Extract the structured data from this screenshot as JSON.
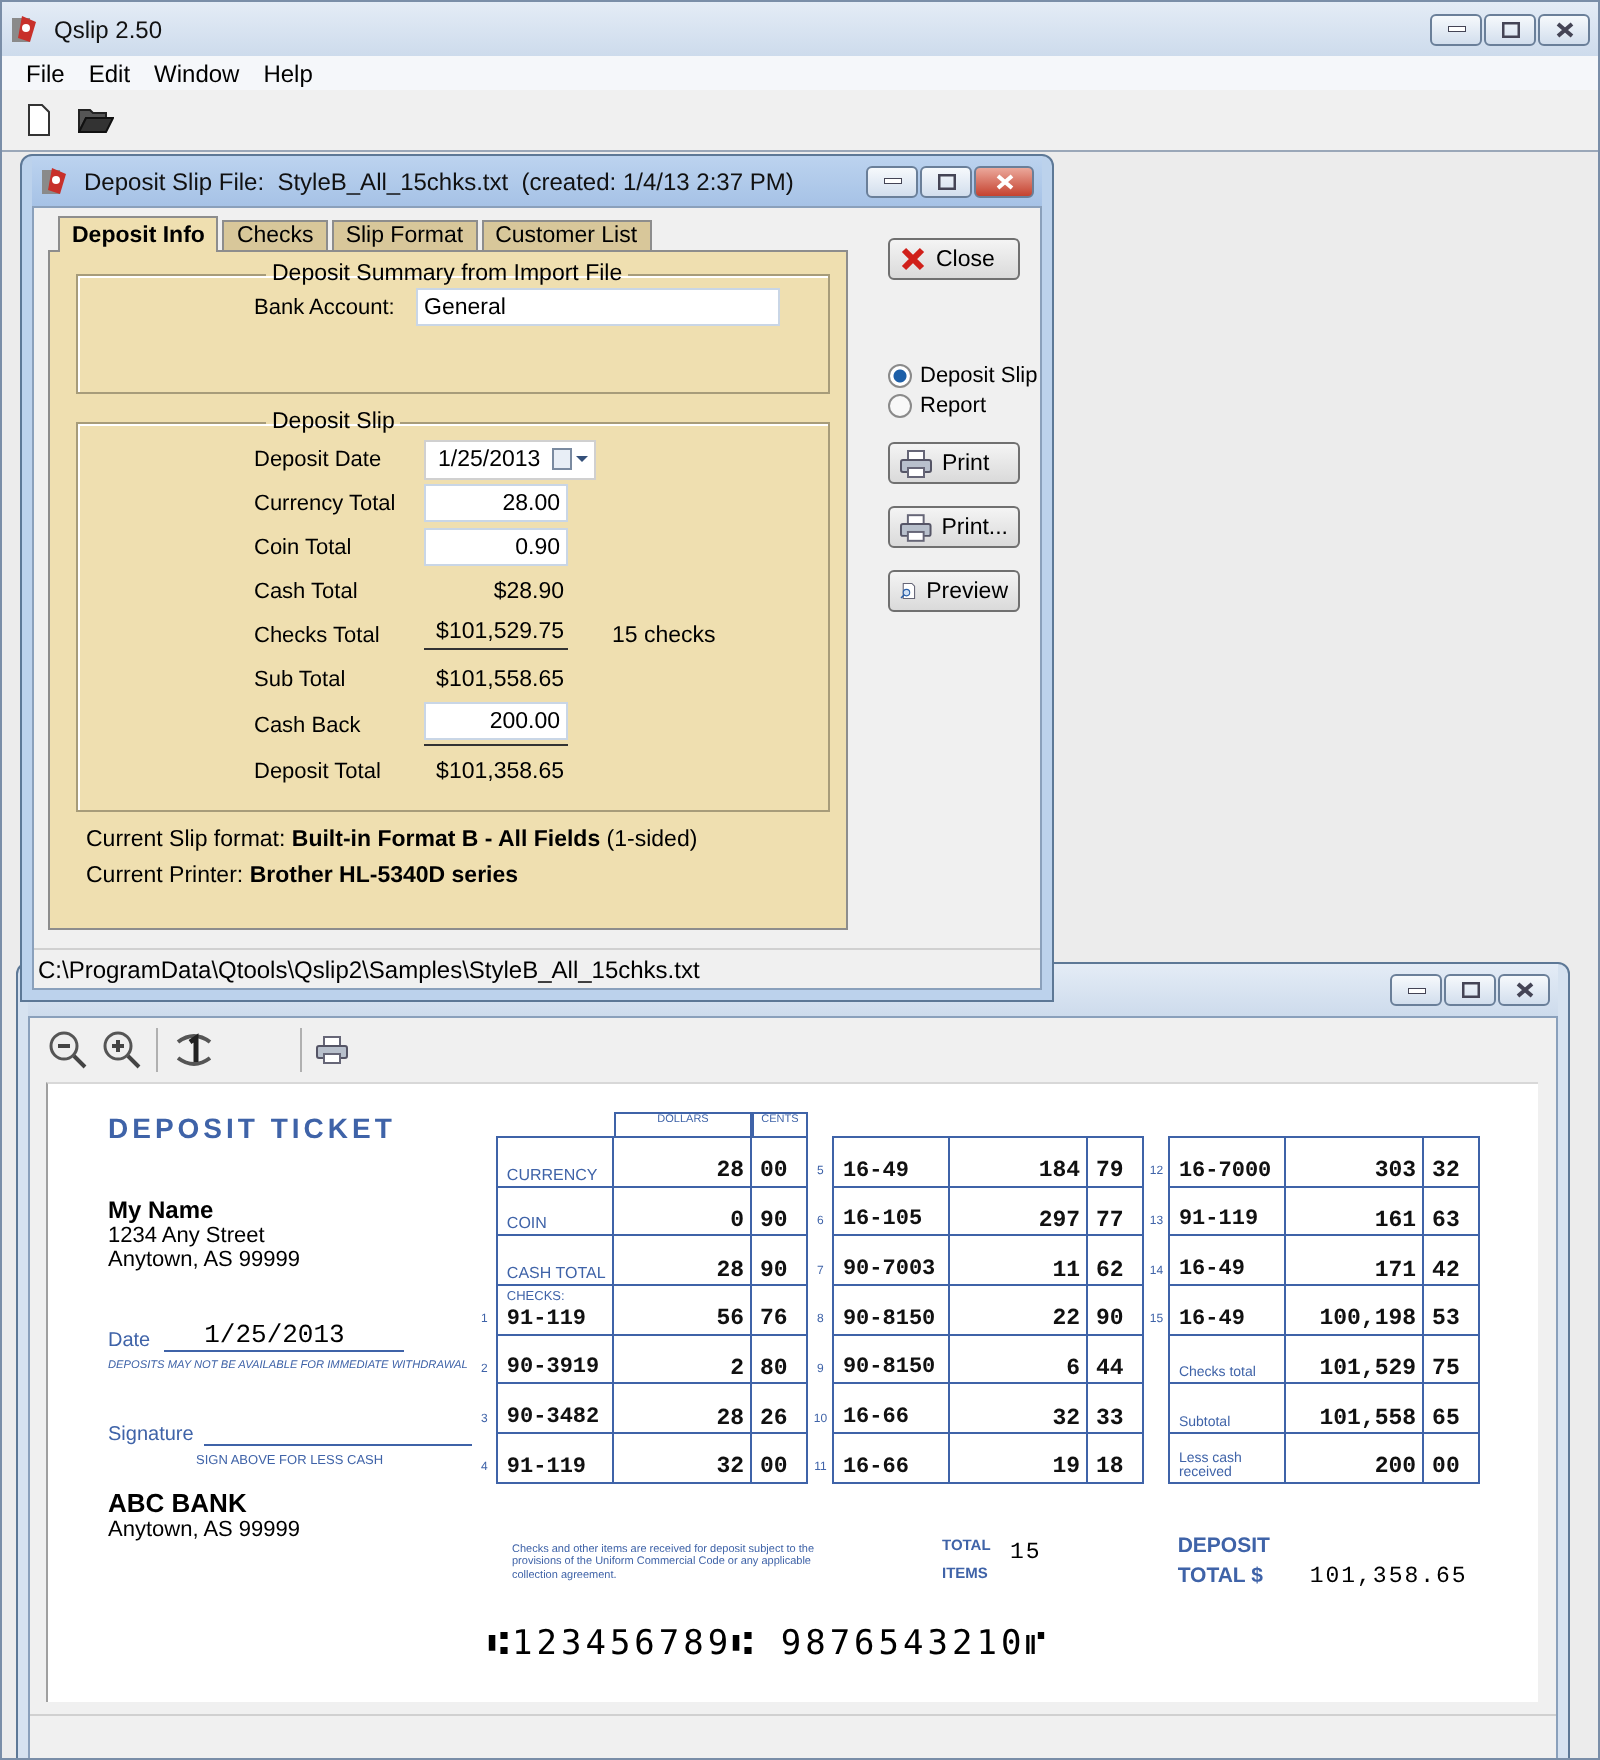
{
  "app": {
    "title": "Qslip 2.50",
    "menu": [
      "File",
      "Edit",
      "Window",
      "Help"
    ]
  },
  "dialog": {
    "title": "Deposit Slip File:  StyleB_All_15chks.txt  (created: 1/4/13 2:37 PM)",
    "tabs": [
      {
        "label": "Deposit Info",
        "selected": true
      },
      {
        "label": "Checks",
        "selected": false
      },
      {
        "label": "Slip Format",
        "selected": false
      },
      {
        "label": "Customer List",
        "selected": false
      }
    ],
    "summary_group": {
      "legend": "Deposit Summary from Import File",
      "label": "Bank Account:",
      "value": "General"
    },
    "slip_group": {
      "legend": "Deposit Slip",
      "rows": [
        {
          "kind": "date",
          "label": "Deposit Date",
          "value": "1/25/2013",
          "rule_below": false
        },
        {
          "kind": "input",
          "label": "Currency Total",
          "value": "28.00",
          "rule_below": false
        },
        {
          "kind": "input",
          "label": "Coin Total",
          "value": "0.90",
          "rule_below": false
        },
        {
          "kind": "text",
          "label": "Cash Total",
          "value": "$28.90",
          "rule_below": false
        },
        {
          "kind": "text",
          "label": "Checks Total",
          "value": "$101,529.75",
          "note": "15 checks",
          "rule_below": true
        },
        {
          "kind": "text",
          "label": "Sub Total",
          "value": "$101,558.65",
          "rule_below": false
        },
        {
          "kind": "input",
          "label": "Cash Back",
          "value": "200.00",
          "rule_below": true
        },
        {
          "kind": "text",
          "label": "Deposit Total",
          "value": "$101,358.65",
          "rule_below": false
        }
      ]
    },
    "footer": [
      "Current Slip format: **Built-in Format B - All Fields** (1-sided)",
      "Current Printer: **Brother HL-5340D series**"
    ],
    "close_button": {
      "label": "Close"
    },
    "output": [
      {
        "label": "Deposit Slip",
        "selected": true
      },
      {
        "label": "Report",
        "selected": false
      }
    ],
    "actions": [
      {
        "kind": "print",
        "label": "Print"
      },
      {
        "kind": "print",
        "label": "Print..."
      },
      {
        "kind": "preview",
        "label": "Preview"
      }
    ],
    "status": "C:\\ProgramData\\Qtools\\Qslip2\\Samples\\StyleB_All_15chks.txt"
  },
  "preview": {
    "ticket": {
      "title": "DEPOSIT TICKET",
      "depositor": {
        "name": "My Name",
        "lines": [
          "1234 Any Street",
          "Anytown, AS 99999"
        ]
      },
      "date_label": "Date",
      "date": "1/25/2013",
      "withdrawal_notice": "DEPOSITS MAY NOT BE AVAILABLE FOR IMMEDIATE WITHDRAWAL",
      "signature_label": "Signature",
      "signature_note": "SIGN ABOVE FOR LESS CASH",
      "bank": {
        "name": "ABC BANK",
        "lines": [
          "Anytown, AS 99999"
        ]
      },
      "column_headers": [
        "DOLLARS",
        "CENTS"
      ],
      "checks_label": "CHECKS:",
      "rows": [
        {
          "kind": "cash",
          "label": "CURRENCY",
          "dollars": "28",
          "cents": "00"
        },
        {
          "kind": "cash",
          "label": "COIN",
          "dollars": "0",
          "cents": "90"
        },
        {
          "kind": "cash",
          "label": "CASH TOTAL",
          "dollars": "28",
          "cents": "90"
        },
        {
          "kind": "check",
          "number": "1",
          "label": "91-119",
          "dollars": "56",
          "cents": "76"
        },
        {
          "kind": "check",
          "number": "2",
          "label": "90-3919",
          "dollars": "2",
          "cents": "80"
        },
        {
          "kind": "check",
          "number": "3",
          "label": "90-3482",
          "dollars": "28",
          "cents": "26"
        },
        {
          "kind": "check",
          "number": "4",
          "label": "91-119",
          "dollars": "32",
          "cents": "00"
        },
        {
          "kind": "check",
          "number": "5",
          "label": "16-49",
          "dollars": "184",
          "cents": "79"
        },
        {
          "kind": "check",
          "number": "6",
          "label": "16-105",
          "dollars": "297",
          "cents": "77"
        },
        {
          "kind": "check",
          "number": "7",
          "label": "90-7003",
          "dollars": "11",
          "cents": "62"
        },
        {
          "kind": "check",
          "number": "8",
          "label": "90-8150",
          "dollars": "22",
          "cents": "90"
        },
        {
          "kind": "check",
          "number": "9",
          "label": "90-8150",
          "dollars": "6",
          "cents": "44"
        },
        {
          "kind": "check",
          "number": "10",
          "label": "16-66",
          "dollars": "32",
          "cents": "33"
        },
        {
          "kind": "check",
          "number": "11",
          "label": "16-66",
          "dollars": "19",
          "cents": "18"
        },
        {
          "kind": "check",
          "number": "12",
          "label": "16-7000",
          "dollars": "303",
          "cents": "32"
        },
        {
          "kind": "check",
          "number": "13",
          "label": "91-119",
          "dollars": "161",
          "cents": "63"
        },
        {
          "kind": "check",
          "number": "14",
          "label": "16-49",
          "dollars": "171",
          "cents": "42"
        },
        {
          "kind": "check",
          "number": "15",
          "label": "16-49",
          "dollars": "100,198",
          "cents": "53"
        },
        {
          "kind": "total",
          "label": "Checks total",
          "dollars": "101,529",
          "cents": "75"
        },
        {
          "kind": "total",
          "label": "Subtotal",
          "dollars": "101,558",
          "cents": "65"
        },
        {
          "kind": "total",
          "label": "Less cash received",
          "dollars": "200",
          "cents": "00"
        }
      ],
      "uc_notice": "Checks and other items are received for deposit subject to the provisions of the Uniform Commercial Code or any applicable collection agreement.",
      "total_items_label": "TOTAL ITEMS",
      "total_items": "15",
      "deposit_total_label": "DEPOSIT TOTAL $",
      "deposit_total": "101,358.65",
      "micr": "⑆123456789⑆ 9876543210⑈"
    }
  }
}
